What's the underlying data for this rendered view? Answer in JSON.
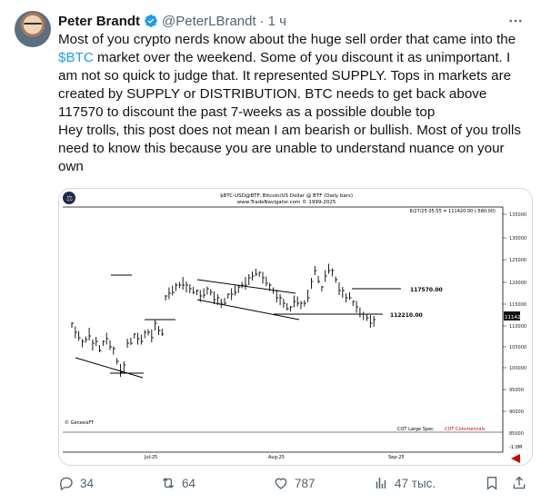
{
  "author": {
    "name": "Peter Brandt",
    "handle": "@PeterLBrandt",
    "separator": "·",
    "time": "1 ч"
  },
  "tweet": {
    "line1_pre": "Most of you crypto nerds know about the huge sell order that came into the ",
    "cashtag": "$BTC",
    "line1_post": " market over the weekend. Some of you discount it as unimportant. I am not so quick to judge that. It represented SUPPLY. Tops in markets are created by SUPPLY or DISTRIBUTION. BTC needs to get back above 117570 to discount the past 7-weeks as a possible double top",
    "paragraph2": "Hey trolls, this post does not mean I am bearish or bullish. Most of you trolls need to know this because you are unable to understand nuance on your own"
  },
  "chart": {
    "title": "$BTC-USD@BTF: Bitcoin/US Dollar @ BTF  (Daily bars)",
    "subtitle": "www.TradeNavigator.com © 1999-2025",
    "quote": "8/27/25 05:55 = 111420.00 (-580.00)",
    "last_price": "111420",
    "level_high": "117570.00",
    "level_low": "112210.00",
    "y_ticks": [
      "125000",
      "120000",
      "115000",
      "110000",
      "105000",
      "100000",
      "95000",
      "90000",
      "85000"
    ],
    "y_top_tick": "135000",
    "y_tick_2": "130000",
    "x_ticks": [
      "Jul-25",
      "Aug-25",
      "Sep-25"
    ],
    "watermark": "© GenesisFT",
    "cot_label": "COT Large Spec",
    "cot_label2": "COT Commercials",
    "cot_value": "-1.0M"
  },
  "actions": {
    "replies": "34",
    "reposts": "64",
    "likes": "787",
    "views": "47 тыс."
  },
  "colors": {
    "accent": "#1d9bf0",
    "muted": "#536471",
    "cot_red": "#cc0000"
  }
}
